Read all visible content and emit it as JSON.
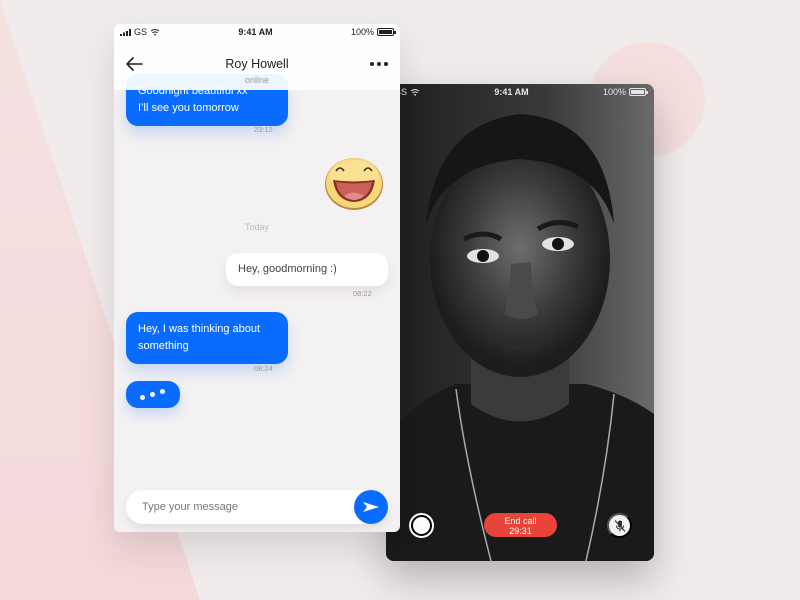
{
  "theme": {
    "accent": "#0a6cff",
    "end_call": "#e8443a",
    "background": "#f1ecec"
  },
  "chat": {
    "status_bar": {
      "carrier": "GS",
      "time": "9:41 AM",
      "battery": "100%"
    },
    "header": {
      "back_icon": "arrow-left-icon",
      "contact_name": "Roy Howell",
      "contact_status": "online",
      "more_icon": "more-dots-icon"
    },
    "messages": [
      {
        "direction": "incoming",
        "lines": [
          "Goodnight beautiful xx",
          "I’ll see you tomorrow"
        ],
        "time": "23:12"
      },
      {
        "direction": "outgoing",
        "type": "sticker",
        "sticker": "laughing-emoji"
      },
      {
        "direction": "outgoing",
        "text": "Hey, goodmorning :)",
        "time": "08:22"
      },
      {
        "direction": "incoming",
        "lines": [
          "Hey, I was thinking about",
          "something"
        ],
        "time": "08:24"
      }
    ],
    "day_separator": "Today",
    "typing_indicator": "typing-dots",
    "composer": {
      "placeholder": "Type your message",
      "value": "",
      "send_icon": "send-icon"
    }
  },
  "video_call": {
    "status_bar": {
      "carrier": "GS",
      "time": "9:41 AM",
      "battery": "100%"
    },
    "end_call_label": "End call",
    "duration": "29:31",
    "controls": [
      "record-icon",
      "mic-off-icon"
    ]
  }
}
